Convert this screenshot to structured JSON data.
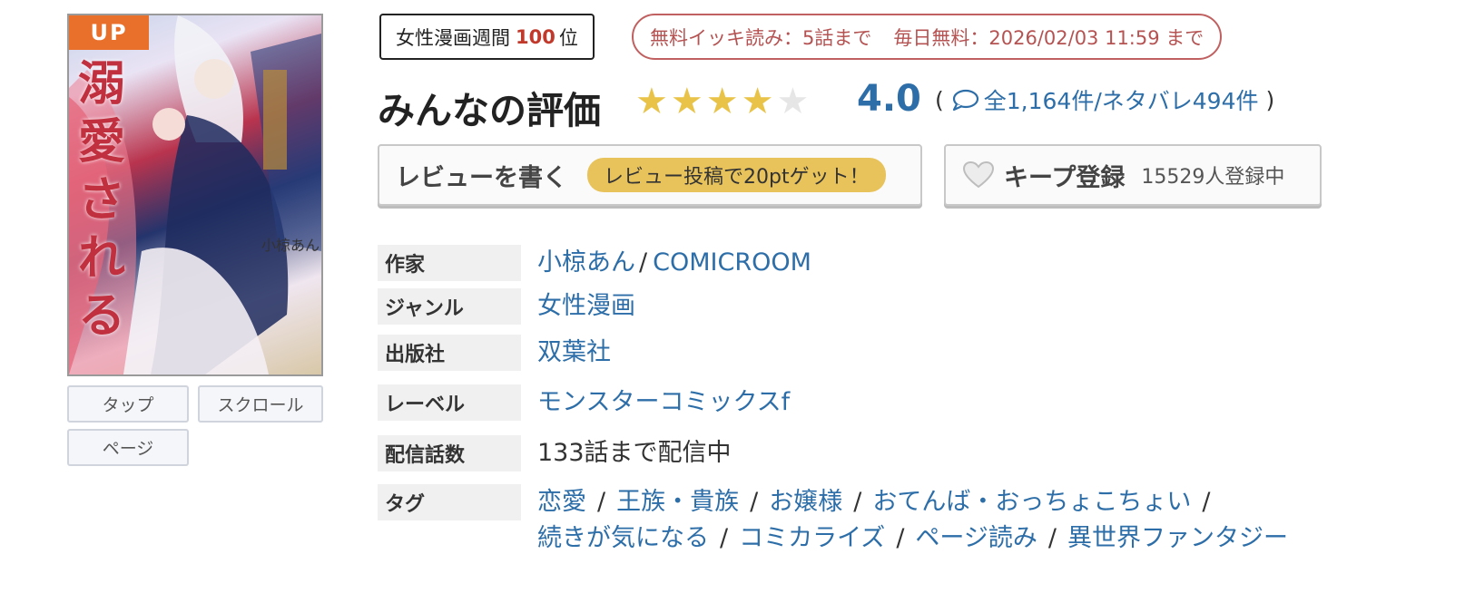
{
  "cover": {
    "badge": "UP",
    "title_art": "溺愛される",
    "author_on_cover": "小椋あん"
  },
  "view_modes": [
    "タップ",
    "スクロール",
    "ページ"
  ],
  "ranking": {
    "prefix": "女性漫画週間",
    "rank": "100",
    "suffix": "位"
  },
  "free_info": {
    "ikki": "無料イッキ読み：5話まで",
    "daily": "毎日無料：2026/02/03 11:59 まで"
  },
  "rating": {
    "title": "みんなの評価",
    "score": "4.0",
    "stars_filled": 4,
    "stars_total": 5,
    "open_paren": "(",
    "close_paren": ")",
    "counts": "全1,164件/ネタバレ494件"
  },
  "actions": {
    "review_label": "レビューを書く",
    "review_bonus": "レビュー投稿で20ptゲット！",
    "keep_label": "キープ登録",
    "keep_count": "15529人登録中"
  },
  "details": {
    "author": {
      "label": "作家",
      "values": [
        "小椋あん",
        "COMICROOM"
      ]
    },
    "genre": {
      "label": "ジャンル",
      "value": "女性漫画"
    },
    "publisher": {
      "label": "出版社",
      "value": "双葉社"
    },
    "imprint": {
      "label": "レーベル",
      "value": "モンスターコミックスf"
    },
    "episodes": {
      "label": "配信話数",
      "value": "133話まで配信中"
    },
    "tags": {
      "label": "タグ",
      "line1": [
        "恋愛",
        "王族・貴族",
        "お嬢様",
        "おてんば・おっちょこちょい"
      ],
      "line2": [
        "続きが気になる",
        "コミカライズ",
        "ページ読み",
        "異世界ファンタジー"
      ]
    }
  },
  "colors": {
    "accent_link": "#2d6ea8",
    "star_on": "#e9c347",
    "star_off": "#e6e6e6",
    "rank_number": "#c0392b",
    "free_badge": "#b55252",
    "up_badge": "#e8702a",
    "bonus_pill": "#e8c35c"
  }
}
